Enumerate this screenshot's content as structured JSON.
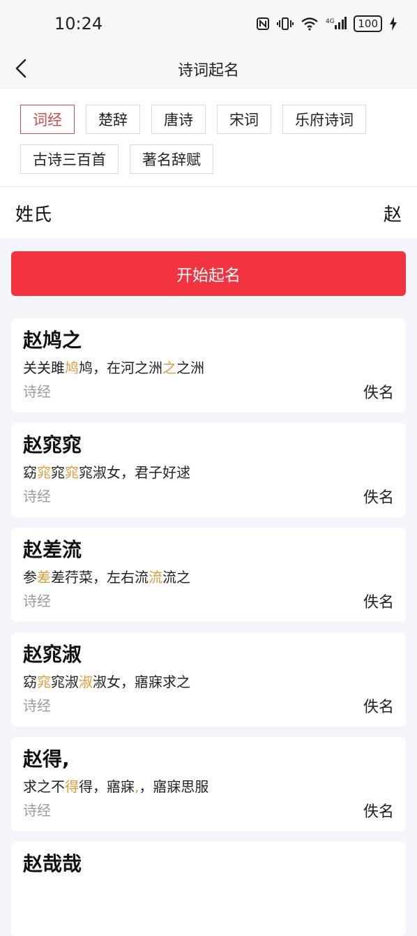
{
  "status": {
    "time": "10:24",
    "battery": "100"
  },
  "nav": {
    "title": "诗词起名"
  },
  "tags": [
    {
      "label": "词经",
      "active": true
    },
    {
      "label": "楚辞",
      "active": false
    },
    {
      "label": "唐诗",
      "active": false
    },
    {
      "label": "宋词",
      "active": false
    },
    {
      "label": "乐府诗词",
      "active": false
    },
    {
      "label": "古诗三百首",
      "active": false
    },
    {
      "label": "著名辞赋",
      "active": false
    }
  ],
  "surname": {
    "label": "姓氏",
    "value": "赵"
  },
  "start_button": "开始起名",
  "results": [
    {
      "name": "赵鸠之",
      "verse": [
        {
          "t": "关关雎",
          "hl": false
        },
        {
          "t": "鸠",
          "hl": true
        },
        {
          "t": "鸠，在河之洲",
          "hl": false
        },
        {
          "t": "之",
          "hl": true
        },
        {
          "t": "之洲",
          "hl": false
        }
      ],
      "source": "诗经",
      "author": "佚名"
    },
    {
      "name": "赵窕窕",
      "verse": [
        {
          "t": "窈",
          "hl": false
        },
        {
          "t": "窕",
          "hl": true
        },
        {
          "t": "窕",
          "hl": false
        },
        {
          "t": "窕",
          "hl": true
        },
        {
          "t": "窕淑女，君子好逑",
          "hl": false
        }
      ],
      "source": "诗经",
      "author": "佚名"
    },
    {
      "name": "赵差流",
      "verse": [
        {
          "t": "参",
          "hl": false
        },
        {
          "t": "差",
          "hl": true
        },
        {
          "t": "差荇菜，左右流",
          "hl": false
        },
        {
          "t": "流",
          "hl": true
        },
        {
          "t": "流之",
          "hl": false
        }
      ],
      "source": "诗经",
      "author": "佚名"
    },
    {
      "name": "赵窕淑",
      "verse": [
        {
          "t": "窈",
          "hl": false
        },
        {
          "t": "窕",
          "hl": true
        },
        {
          "t": "窕淑",
          "hl": false
        },
        {
          "t": "淑",
          "hl": true
        },
        {
          "t": "淑女，寤寐求之",
          "hl": false
        }
      ],
      "source": "诗经",
      "author": "佚名"
    },
    {
      "name": "赵得,",
      "verse": [
        {
          "t": "求之不",
          "hl": false
        },
        {
          "t": "得",
          "hl": true
        },
        {
          "t": "得，寤寐",
          "hl": false
        },
        {
          "t": ",",
          "hl": true
        },
        {
          "t": "，寤寐思服",
          "hl": false
        }
      ],
      "source": "诗经",
      "author": "佚名"
    },
    {
      "name": "赵哉哉",
      "verse": [],
      "source": "",
      "author": ""
    }
  ],
  "colors": {
    "accent_red": "#f1343f",
    "tag_active": "#d44b4b",
    "highlight": "#e39a3b"
  },
  "icons": {
    "back": "chevron-left-icon",
    "nfc": "nfc-icon",
    "vibrate": "vibrate-icon",
    "wifi": "wifi-icon",
    "signal": "signal-4g-icon",
    "battery": "battery-icon",
    "charging": "charging-bolt-icon"
  }
}
